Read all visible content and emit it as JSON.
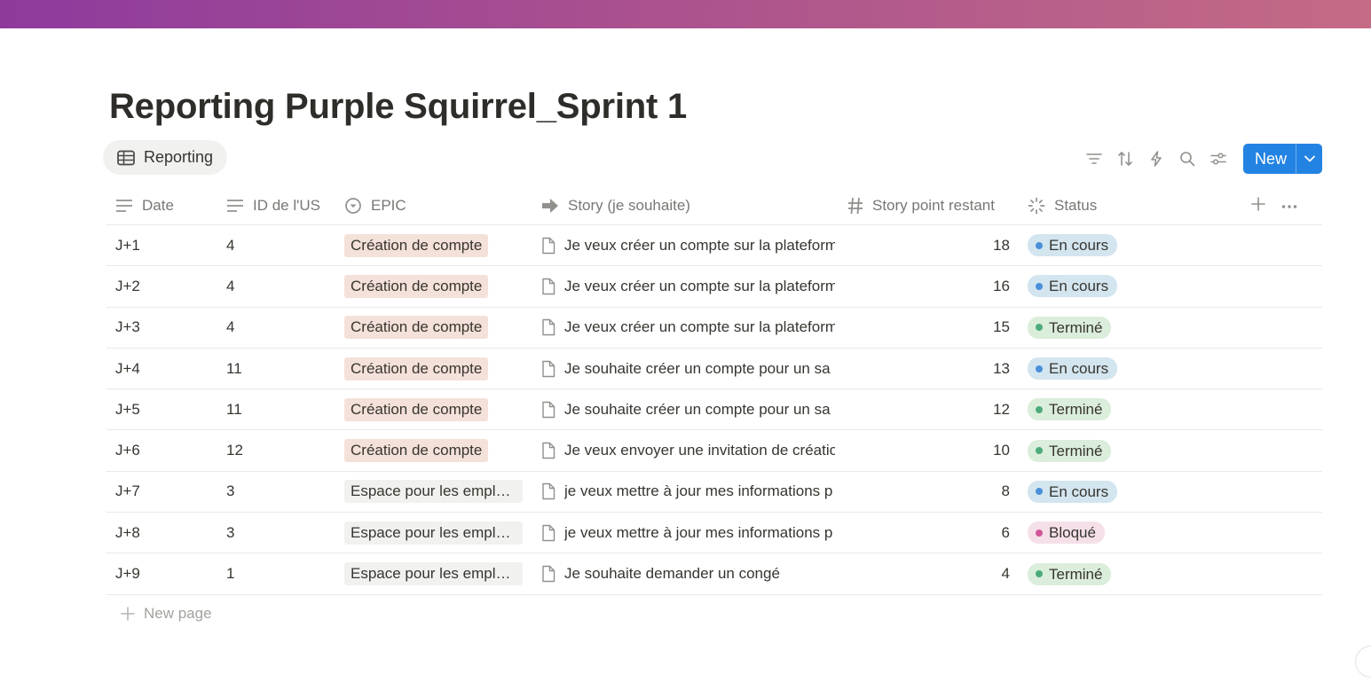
{
  "page": {
    "title": "Reporting Purple Squirrel_Sprint 1",
    "view_tab": "Reporting",
    "new_button": "New",
    "new_page_label": "New page"
  },
  "toolbar_icons": [
    "filter-icon",
    "sort-icon",
    "lightning-icon",
    "search-icon",
    "settings-sliders-icon"
  ],
  "columns": {
    "date": "Date",
    "id": "ID de l'US",
    "epic": "EPIC",
    "story": "Story (je souhaite)",
    "points": "Story point restant",
    "status": "Status"
  },
  "colors": {
    "accent": "#2383e2",
    "epic_account_bg": "#f4e1d9",
    "epic_space_bg": "#f1f1ef",
    "status_en_cours_bg": "#d3e5ef",
    "status_en_cours_dot": "#4a90d9",
    "status_termine_bg": "#dbeddb",
    "status_termine_dot": "#4dab7a",
    "status_bloque_bg": "#f5e0e9",
    "status_bloque_dot": "#d15796"
  },
  "rows": [
    {
      "date": "J+1",
      "id": "4",
      "epic": "Création de compte",
      "epic_kind": "account",
      "story": "Je veux créer un compte sur la plateforme",
      "points": "18",
      "status": "En cours",
      "status_kind": "en_cours"
    },
    {
      "date": "J+2",
      "id": "4",
      "epic": "Création de compte",
      "epic_kind": "account",
      "story": "Je veux créer un compte sur la plateforme",
      "points": "16",
      "status": "En cours",
      "status_kind": "en_cours"
    },
    {
      "date": "J+3",
      "id": "4",
      "epic": "Création de compte",
      "epic_kind": "account",
      "story": "Je veux créer un compte sur la plateforme",
      "points": "15",
      "status": "Terminé",
      "status_kind": "termine"
    },
    {
      "date": "J+4",
      "id": "11",
      "epic": "Création de compte",
      "epic_kind": "account",
      "story": "Je souhaite créer un compte pour un sa",
      "points": "13",
      "status": "En cours",
      "status_kind": "en_cours"
    },
    {
      "date": "J+5",
      "id": "11",
      "epic": "Création de compte",
      "epic_kind": "account",
      "story": "Je souhaite créer un compte pour un sa",
      "points": "12",
      "status": "Terminé",
      "status_kind": "termine"
    },
    {
      "date": "J+6",
      "id": "12",
      "epic": "Création de compte",
      "epic_kind": "account",
      "story": "Je veux envoyer une invitation de création",
      "points": "10",
      "status": "Terminé",
      "status_kind": "termine"
    },
    {
      "date": "J+7",
      "id": "3",
      "epic": "Espace pour les emplo...",
      "epic_kind": "space",
      "story": "je veux mettre à jour mes informations p",
      "points": "8",
      "status": "En cours",
      "status_kind": "en_cours"
    },
    {
      "date": "J+8",
      "id": "3",
      "epic": "Espace pour les emplo...",
      "epic_kind": "space",
      "story": "je veux mettre à jour mes informations p",
      "points": "6",
      "status": "Bloqué",
      "status_kind": "bloque"
    },
    {
      "date": "J+9",
      "id": "1",
      "epic": "Espace pour les emplo...",
      "epic_kind": "space",
      "story": "Je souhaite demander un congé",
      "points": "4",
      "status": "Terminé",
      "status_kind": "termine"
    }
  ]
}
